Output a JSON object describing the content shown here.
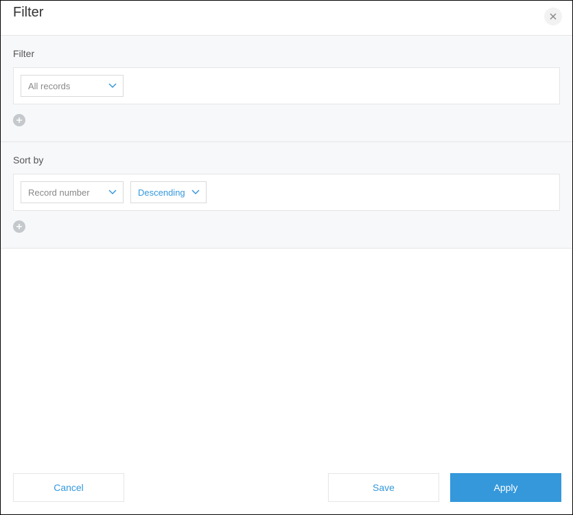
{
  "header": {
    "title": "Filter"
  },
  "filter_section": {
    "label": "Filter",
    "selects": [
      {
        "value": "All records",
        "blue": false
      }
    ]
  },
  "sort_section": {
    "label": "Sort by",
    "selects": [
      {
        "value": "Record number",
        "blue": false
      },
      {
        "value": "Descending",
        "blue": true
      }
    ]
  },
  "footer": {
    "cancel": "Cancel",
    "save": "Save",
    "apply": "Apply"
  }
}
